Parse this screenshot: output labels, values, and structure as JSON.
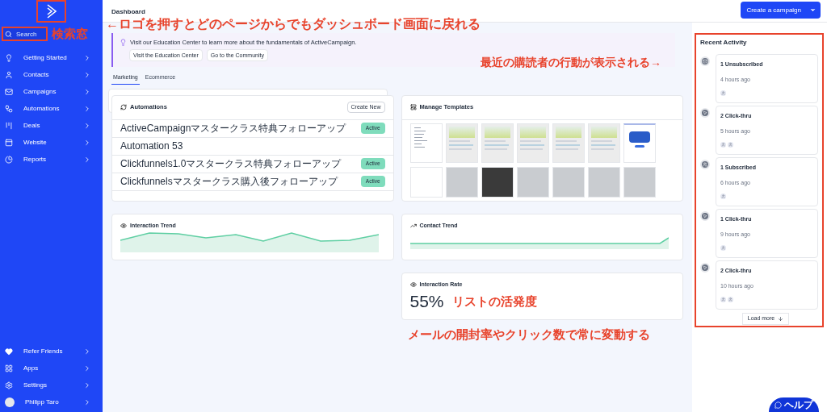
{
  "sidebar": {
    "search": {
      "placeholder": "Search"
    },
    "items": [
      {
        "label": "Getting Started"
      },
      {
        "label": "Contacts"
      },
      {
        "label": "Campaigns"
      },
      {
        "label": "Automations"
      },
      {
        "label": "Deals"
      },
      {
        "label": "Website"
      },
      {
        "label": "Reports"
      }
    ],
    "bottom_items": [
      {
        "label": "Refer Friends"
      },
      {
        "label": "Apps"
      },
      {
        "label": "Settings"
      },
      {
        "label": "Philipp Taro"
      }
    ]
  },
  "header": {
    "title": "Dashboard",
    "button": "Create a campaign"
  },
  "banner": {
    "text": "Visit our Education Center to learn more about the fundamentals of ActiveCampaign.",
    "buttons": [
      "Visit the Education Center",
      "Go to the Community"
    ]
  },
  "tabs": [
    {
      "label": "Marketing",
      "selected": true
    },
    {
      "label": "Ecommerce",
      "selected": false
    }
  ],
  "automations": {
    "title": "Automations",
    "button": "Create New",
    "rows": [
      {
        "name": "ActiveCampaignマスタークラス特典フォローアップ",
        "status": "Active"
      },
      {
        "name": "Automation 53"
      },
      {
        "name": "Clickfunnels1.0マスタークラス特典フォローアップ",
        "status": "Active"
      },
      {
        "name": "Clickfunnelsマスタークラス購入後フォローアップ",
        "status": "Active"
      }
    ]
  },
  "templates": {
    "title": "Manage Templates",
    "items": [
      {
        "kind": "text"
      },
      {
        "kind": "landscape"
      },
      {
        "kind": "landscape"
      },
      {
        "kind": "landscape"
      },
      {
        "kind": "landscape"
      },
      {
        "kind": "landscape"
      },
      {
        "kind": "device"
      },
      {
        "kind": "blank"
      },
      {
        "kind": "photo"
      },
      {
        "kind": "dark"
      },
      {
        "kind": "photo"
      },
      {
        "kind": "photo"
      },
      {
        "kind": "photo"
      },
      {
        "kind": "photo"
      }
    ]
  },
  "interaction_trend": {
    "title": "Interaction Trend"
  },
  "contact_trend": {
    "title": "Contact Trend"
  },
  "interaction_rate": {
    "title": "Interaction Rate",
    "value": "55%"
  },
  "recent_activity": {
    "title": "Recent Activity",
    "button": "Load more",
    "items": [
      {
        "kind": "unsubscribed",
        "title": "1 Unsubscribed",
        "time": "4 hours ago",
        "contacts": [
          {
            "kind": "contact"
          }
        ]
      },
      {
        "kind": "click",
        "title": "2 Click-thru",
        "time": "5 hours ago",
        "contacts": [
          {
            "kind": "contact"
          },
          {
            "kind": "contact"
          }
        ]
      },
      {
        "kind": "subscribed",
        "title": "1 Subscribed",
        "time": "6 hours ago",
        "contacts": [
          {
            "kind": "contact"
          }
        ]
      },
      {
        "kind": "click",
        "title": "1 Click-thru",
        "time": "9 hours ago",
        "contacts": [
          {
            "kind": "contact"
          }
        ]
      },
      {
        "kind": "click",
        "title": "2 Click-thru",
        "time": "10 hours ago",
        "contacts": [
          {
            "kind": "contact"
          },
          {
            "kind": "contact"
          }
        ]
      }
    ]
  },
  "help_button": "ヘルプ",
  "annotations": {
    "logo_note": "←ロゴを押すとどのページからでもダッシュボード画面に戻れる",
    "search_note": "検索窓",
    "activity_note": "最近の購読者の行動が表示される→",
    "rate_note": "リストの活発度",
    "rate_detail_note": "メールの開封率やクリック数で常に変動する"
  }
}
